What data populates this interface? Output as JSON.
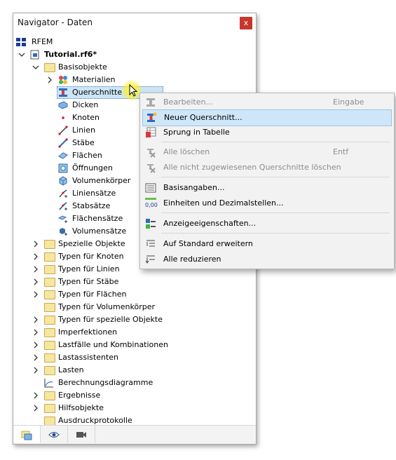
{
  "window": {
    "title": "Navigator - Daten",
    "close_label": "x"
  },
  "tree": {
    "root": "RFEM",
    "file": "Tutorial.rf6*",
    "basis": "Basisobjekte",
    "basis_children": [
      "Materialien",
      "Querschnitte",
      "Dicken",
      "Knoten",
      "Linien",
      "Stäbe",
      "Flächen",
      "Öffnungen",
      "Volumenkörper",
      "Liniensätze",
      "Stabsätze",
      "Flächensätze",
      "Volumensätze"
    ],
    "folders": [
      "Spezielle Objekte",
      "Typen für Knoten",
      "Typen für Linien",
      "Typen für Stäbe",
      "Typen für Flächen",
      "Typen für Volumenkörper",
      "Typen für spezielle Objekte",
      "Imperfektionen",
      "Lastfälle und Kombinationen",
      "Lastassistenten",
      "Lasten",
      "Berechnungsdiagramme",
      "Ergebnisse",
      "Hilfsobjekte",
      "Ausdruckprotokolle"
    ]
  },
  "context_menu": {
    "items": [
      {
        "label": "Bearbeiten...",
        "shortcut": "Eingabe"
      },
      {
        "label": "Neuer Querschnitt..."
      },
      {
        "label": "Sprung in Tabelle"
      },
      {
        "label": "Alle löschen",
        "shortcut": "Entf"
      },
      {
        "label": "Alle nicht zugewiesenen Querschnitte löschen"
      },
      {
        "label": "Basisangaben..."
      },
      {
        "label": "Einheiten und Dezimalstellen..."
      },
      {
        "label": "Anzeigeeigenschaften..."
      },
      {
        "label": "Auf Standard erweitern"
      },
      {
        "label": "Alle reduzieren"
      }
    ],
    "units_icon_text": "0,00"
  },
  "colors": {
    "selection": "#cde6f7",
    "highlight": "#cfe6f8",
    "close": "#c8372d"
  }
}
